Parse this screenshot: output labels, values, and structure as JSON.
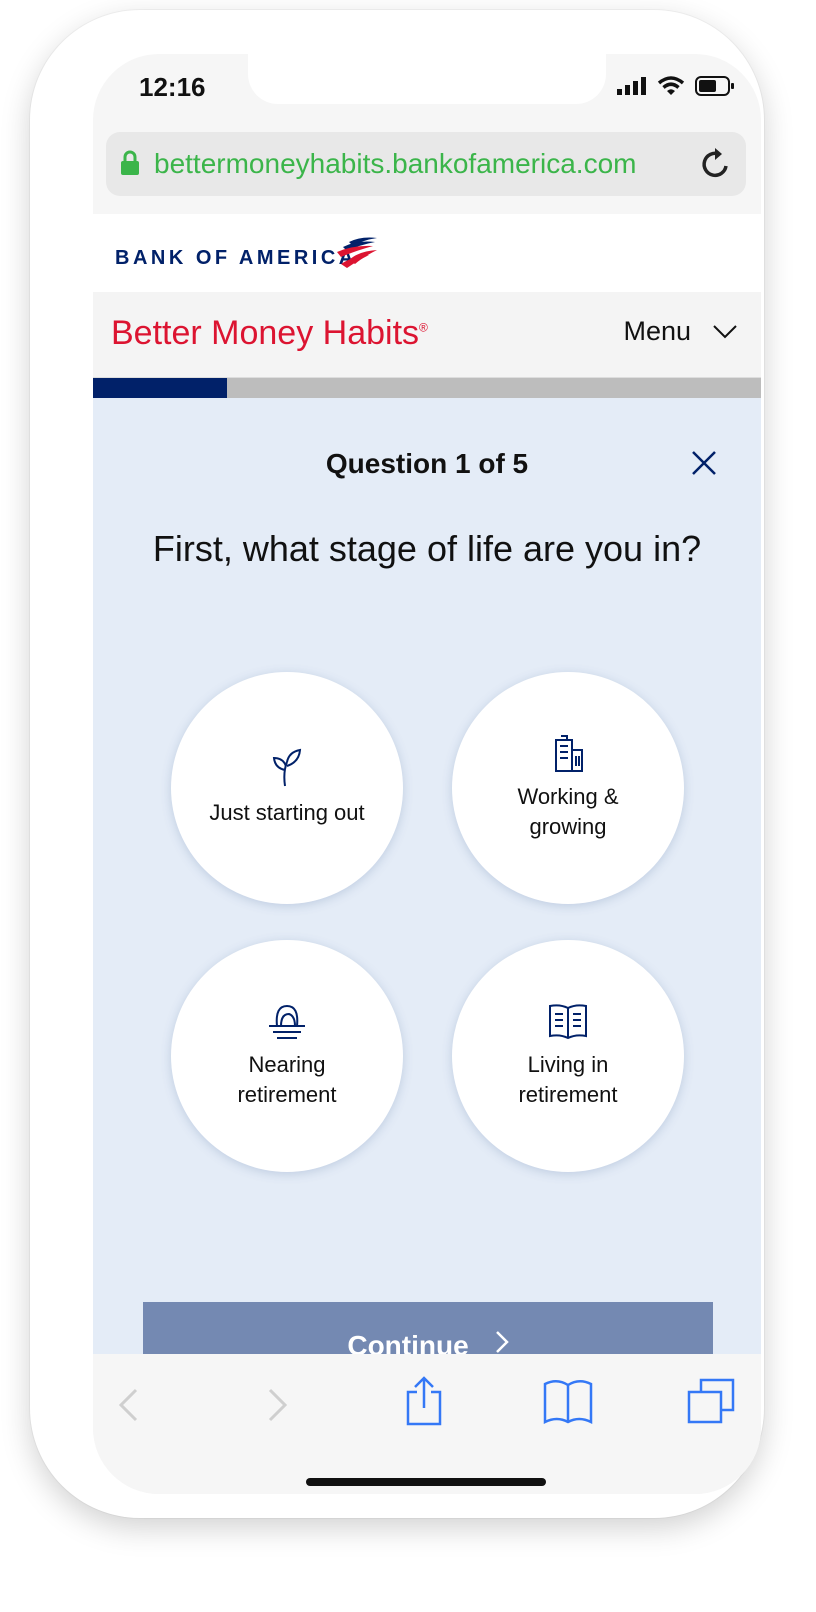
{
  "status_bar": {
    "time": "12:16"
  },
  "browser": {
    "url": "bettermoneyhabits.bankofamerica.com"
  },
  "brand": {
    "name": "BANK OF AMERICA"
  },
  "header": {
    "title": "Better Money Habits",
    "registered": "®",
    "menu_label": "Menu"
  },
  "quiz": {
    "progress_fraction": 0.2,
    "question_counter": "Question 1 of 5",
    "question": "First, what stage of life are you in?",
    "options": [
      {
        "label": "Just starting out",
        "icon": "sprout-icon"
      },
      {
        "label": "Working & growing",
        "icon": "building-icon"
      },
      {
        "label": "Nearing retirement",
        "icon": "nest-egg-icon"
      },
      {
        "label": "Living in retirement",
        "icon": "open-book-icon"
      }
    ],
    "continue_label": "Continue"
  },
  "colors": {
    "brand_navy": "#012169",
    "brand_red": "#dc1431",
    "url_green": "#3bb54a",
    "quiz_bg": "#e4ecf7",
    "button_disabled": "#7489b2",
    "ios_blue": "#3478f6"
  }
}
